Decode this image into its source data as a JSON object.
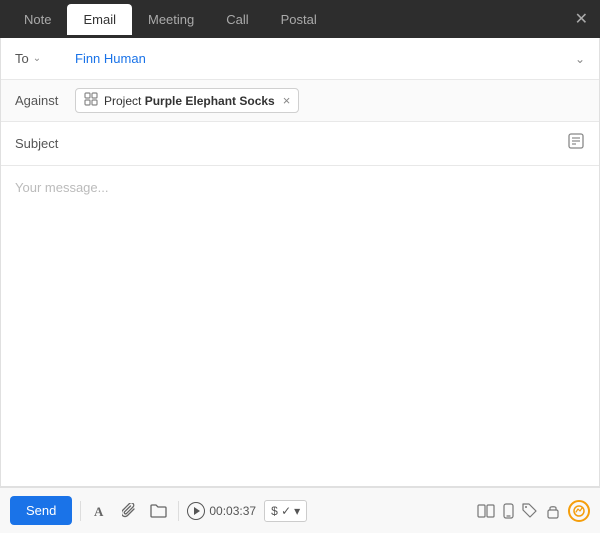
{
  "tabs": [
    {
      "id": "note",
      "label": "Note",
      "active": false
    },
    {
      "id": "email",
      "label": "Email",
      "active": true
    },
    {
      "id": "meeting",
      "label": "Meeting",
      "active": false
    },
    {
      "id": "call",
      "label": "Call",
      "active": false
    },
    {
      "id": "postal",
      "label": "Postal",
      "active": false
    }
  ],
  "close_icon": "✕",
  "to": {
    "label": "To",
    "value": "Finn Human",
    "expand_icon": "⌄"
  },
  "against": {
    "label": "Against",
    "tag_icon": "⊞",
    "tag_text_prefix": "Project ",
    "tag_text_bold": "Purple Elephant Socks",
    "close_icon": "×"
  },
  "subject": {
    "label": "Subject",
    "template_icon": "📋"
  },
  "message": {
    "placeholder": "Your message..."
  },
  "toolbar": {
    "send_label": "Send",
    "timer_value": "00:03:37",
    "currency_label": "$ ✓",
    "dropdown_arrow": "▾",
    "activity_badge": "⚡"
  }
}
